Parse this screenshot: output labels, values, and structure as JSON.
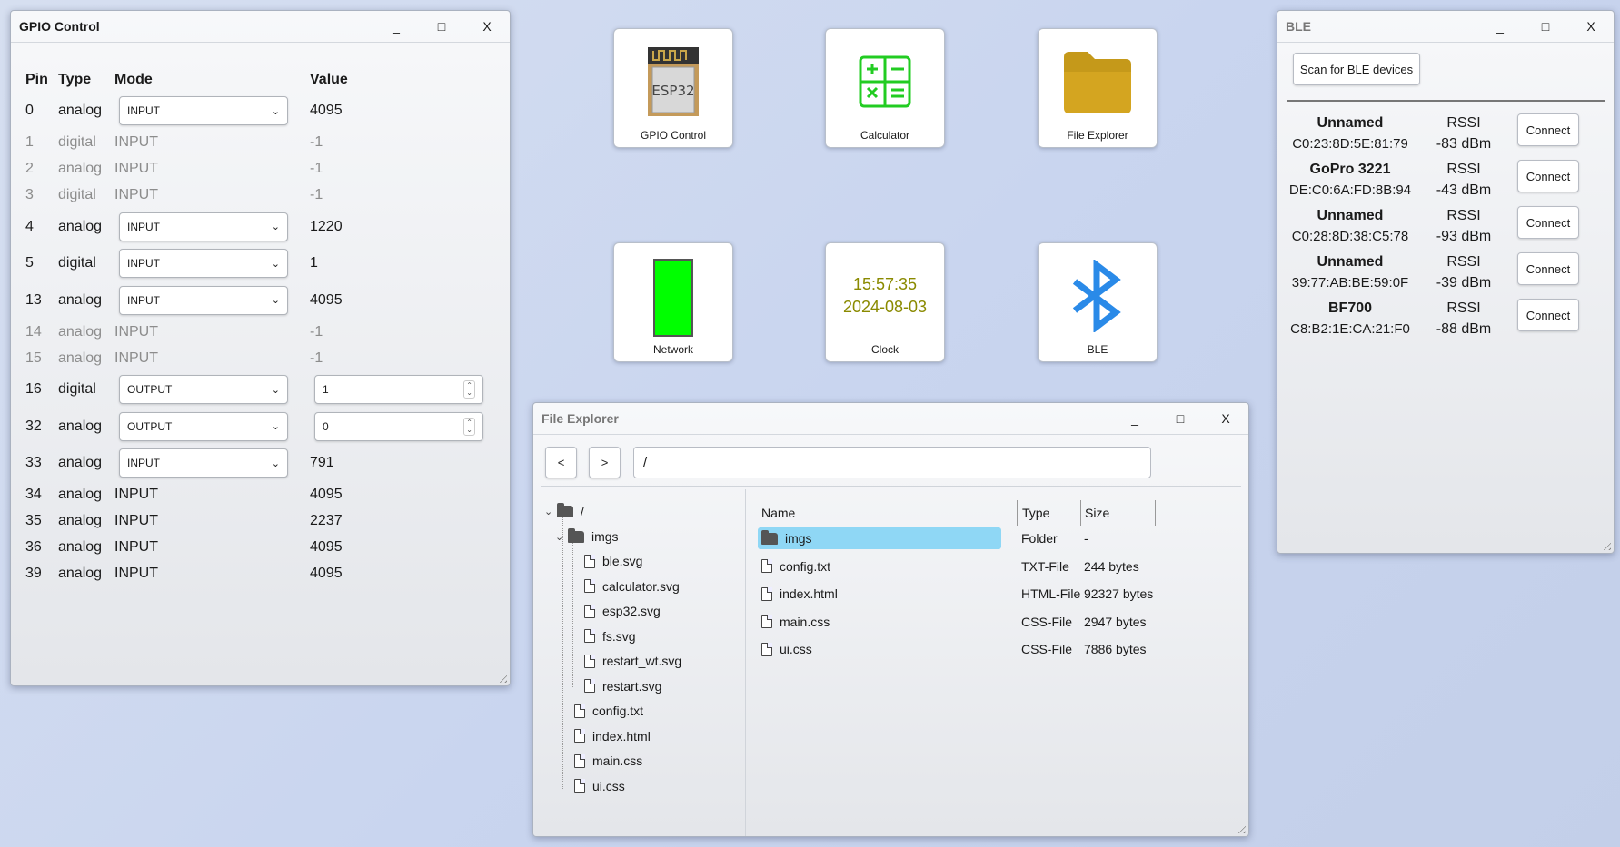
{
  "gpio": {
    "title": "GPIO Control",
    "controls": {
      "minimize": "_",
      "maximize": "□",
      "close": "X"
    },
    "headers": {
      "pin": "Pin",
      "type": "Type",
      "mode": "Mode",
      "value": "Value"
    },
    "rows": [
      {
        "pin": "0",
        "type": "analog",
        "mode": "INPUT",
        "value": "4095",
        "kind": "select"
      },
      {
        "pin": "1",
        "type": "digital",
        "mode": "INPUT",
        "value": "-1",
        "kind": "disabled"
      },
      {
        "pin": "2",
        "type": "analog",
        "mode": "INPUT",
        "value": "-1",
        "kind": "disabled"
      },
      {
        "pin": "3",
        "type": "digital",
        "mode": "INPUT",
        "value": "-1",
        "kind": "disabled"
      },
      {
        "pin": "4",
        "type": "analog",
        "mode": "INPUT",
        "value": "1220",
        "kind": "select"
      },
      {
        "pin": "5",
        "type": "digital",
        "mode": "INPUT",
        "value": "1",
        "kind": "select"
      },
      {
        "pin": "13",
        "type": "analog",
        "mode": "INPUT",
        "value": "4095",
        "kind": "select"
      },
      {
        "pin": "14",
        "type": "analog",
        "mode": "INPUT",
        "value": "-1",
        "kind": "disabled"
      },
      {
        "pin": "15",
        "type": "analog",
        "mode": "INPUT",
        "value": "-1",
        "kind": "disabled"
      },
      {
        "pin": "16",
        "type": "digital",
        "mode": "OUTPUT",
        "value": "1",
        "kind": "output"
      },
      {
        "pin": "32",
        "type": "analog",
        "mode": "OUTPUT",
        "value": "0",
        "kind": "output"
      },
      {
        "pin": "33",
        "type": "analog",
        "mode": "INPUT",
        "value": "791",
        "kind": "select"
      },
      {
        "pin": "34",
        "type": "analog",
        "mode": "INPUT",
        "value": "4095",
        "kind": "static"
      },
      {
        "pin": "35",
        "type": "analog",
        "mode": "INPUT",
        "value": "2237",
        "kind": "static"
      },
      {
        "pin": "36",
        "type": "analog",
        "mode": "INPUT",
        "value": "4095",
        "kind": "static"
      },
      {
        "pin": "39",
        "type": "analog",
        "mode": "INPUT",
        "value": "4095",
        "kind": "static"
      }
    ]
  },
  "desktop": {
    "icons": [
      {
        "label": "GPIO Control",
        "icon": "esp32-chip-icon",
        "chip_text": "ESP32"
      },
      {
        "label": "Calculator",
        "icon": "calculator-icon"
      },
      {
        "label": "File Explorer",
        "icon": "folder-icon"
      },
      {
        "label": "Network",
        "icon": "network-signal-icon"
      },
      {
        "label": "Clock",
        "icon": "clock-icon",
        "time": "15:57:35",
        "date": "2024-08-03"
      },
      {
        "label": "BLE",
        "icon": "bluetooth-icon"
      }
    ],
    "colors": {
      "calculator": "#22cc22",
      "folder": "#d4a520",
      "network": "#00ff00",
      "clock_text": "#8a8a00",
      "bluetooth": "#2a8ae8"
    }
  },
  "ble": {
    "title": "BLE",
    "controls": {
      "minimize": "_",
      "maximize": "□",
      "close": "X"
    },
    "scan_label": "Scan for BLE devices",
    "rssi_label": "RSSI",
    "connect_label": "Connect",
    "devices": [
      {
        "name": "Unnamed",
        "mac": "C0:23:8D:5E:81:79",
        "rssi": "-83 dBm"
      },
      {
        "name": "GoPro 3221",
        "mac": "DE:C0:6A:FD:8B:94",
        "rssi": "-43 dBm"
      },
      {
        "name": "Unnamed",
        "mac": "C0:28:8D:38:C5:78",
        "rssi": "-93 dBm"
      },
      {
        "name": "Unnamed",
        "mac": "39:77:AB:BE:59:0F",
        "rssi": "-39 dBm"
      },
      {
        "name": "BF700",
        "mac": "C8:B2:1E:CA:21:F0",
        "rssi": "-88 dBm"
      }
    ]
  },
  "explorer": {
    "title": "File Explorer",
    "controls": {
      "minimize": "_",
      "maximize": "□",
      "close": "X"
    },
    "back_label": "<",
    "forward_label": ">",
    "path": "/",
    "tree": {
      "root": "/",
      "imgs": "imgs",
      "img_files": [
        "ble.svg",
        "calculator.svg",
        "esp32.svg",
        "fs.svg",
        "restart_wt.svg",
        "restart.svg"
      ],
      "root_files": [
        "config.txt",
        "index.html",
        "main.css",
        "ui.css"
      ]
    },
    "columns": {
      "name": "Name",
      "type": "Type",
      "size": "Size"
    },
    "entries": [
      {
        "name": "imgs",
        "type": "Folder",
        "size": "-",
        "folder": true
      },
      {
        "name": "config.txt",
        "type": "TXT-File",
        "size": "244 bytes"
      },
      {
        "name": "index.html",
        "type": "HTML-File",
        "size": "92327 bytes"
      },
      {
        "name": "main.css",
        "type": "CSS-File",
        "size": "2947 bytes"
      },
      {
        "name": "ui.css",
        "type": "CSS-File",
        "size": "7886 bytes"
      }
    ]
  }
}
